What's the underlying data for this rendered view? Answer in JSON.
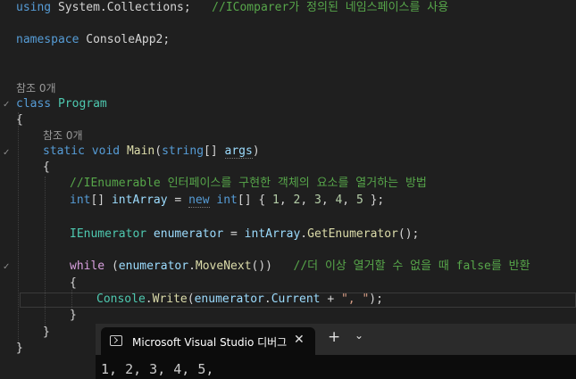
{
  "editor": {
    "l1_using": "using",
    "l1_ns": "System.Collections;",
    "l1_comment": "//IComparer가 정의된 네임스페이스를 사용",
    "l3_namespace": "namespace",
    "l3_name": "ConsoleApp2;",
    "lens_class": "참조 0개",
    "l7_class": "class",
    "l7_name": "Program",
    "brace_open": "{",
    "brace_close": "}",
    "lens_main": "참조 0개",
    "main_static": "static",
    "main_void": "void",
    "main_name": "Main",
    "main_p1": "(",
    "main_string": "string",
    "main_p2": "[] ",
    "main_args": "args",
    "main_p3": ")",
    "c1": "//IEnumerable 인터페이스를 구현한 객체의 요소를 열거하는 방법",
    "arr_int": "int",
    "arr_brk": "[] ",
    "arr_name": "intArray",
    "arr_eq": " = ",
    "arr_new": "new",
    "arr_sp": " ",
    "arr_int2": "int",
    "arr_b2": "[] { ",
    "n1": "1",
    "n2": "2",
    "n3": "3",
    "n4": "4",
    "n5": "5",
    "comma": ", ",
    "arr_end": " };",
    "en_type": "IEnumerator",
    "en_name": " enumerator",
    "en_eq": " = ",
    "en_arr": "intArray",
    "en_dot": ".",
    "en_fn": "GetEnumerator",
    "en_end": "();",
    "wh_kw": "while",
    "wh_p1": " (",
    "wh_en": "enumerator",
    "wh_dot": ".",
    "wh_fn": "MoveNext",
    "wh_p2": "())",
    "wh_cm": "//더 이상 열거할 수 없을 때 false를 반환",
    "cw_cls": "Console",
    "cw_dot": ".",
    "cw_fn": "Write",
    "cw_p1": "(",
    "cw_en": "enumerator",
    "cw_dot2": ".",
    "cw_cur": "Current",
    "cw_plus": " + ",
    "cw_str": "\", \"",
    "cw_end": ");"
  },
  "terminal": {
    "tab_title": "Microsoft Visual Studio 디버그",
    "close": "✕",
    "add": "+",
    "dropdown": "⌄",
    "output": "1, 2, 3, 4, 5,"
  }
}
